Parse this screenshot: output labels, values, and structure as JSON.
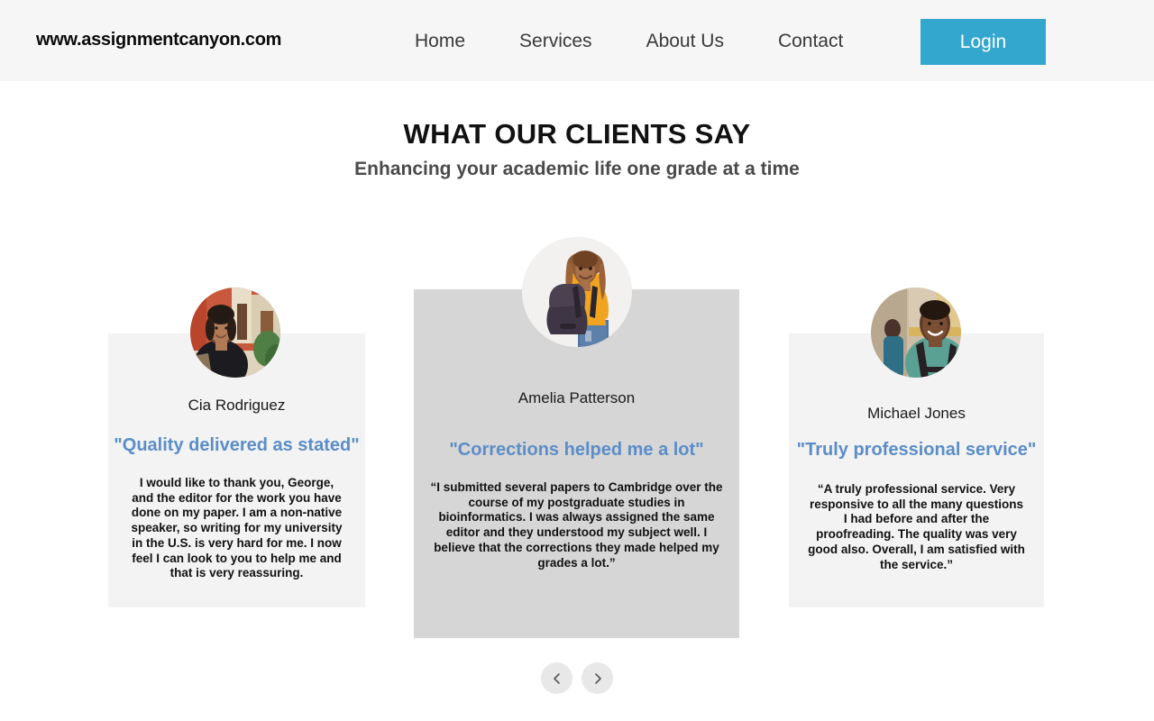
{
  "header": {
    "brand": "www.assignmentcanyon.com",
    "nav": [
      {
        "label": "Home"
      },
      {
        "label": "Services"
      },
      {
        "label": "About Us"
      },
      {
        "label": "Contact"
      }
    ],
    "login_label": "Login",
    "login_color": "#34a7ce",
    "background": "#f6f6f6"
  },
  "section": {
    "title": "WHAT OUR CLIENTS SAY",
    "subtitle": "Enhancing your academic life one grade at a time",
    "headline_color": "#5b8dc8"
  },
  "testimonials": [
    {
      "name": "Cia Rodriguez",
      "headline": "\"Quality delivered as stated\"",
      "quote": "I would like to thank you, George, and the editor for the work you have done on my paper. I am a non-native speaker, so writing for my university in the U.S. is very hard for me. I now feel I can look to you to help me and that is very reassuring.",
      "avatar": "avatar-woman-dark-top",
      "card_color": "#f3f3f3"
    },
    {
      "name": "Amelia Patterson",
      "headline": "\"Corrections helped me a lot\"",
      "quote": "“I submitted several papers to Cambridge over the course of my postgraduate studies in bioinformatics. I was always assigned the same editor and they understood my subject well. I believe that the corrections they made helped my grades a lot.”",
      "avatar": "avatar-woman-yellow-top",
      "card_color": "#d6d6d6"
    },
    {
      "name": "Michael Jones",
      "headline": "\"Truly professional service\"",
      "quote": "“A truly professional service. Very responsive to all the many questions I had before and after the proofreading. The quality was very good also. Overall, I am satisfied with the service.”",
      "avatar": "avatar-man-teal-shirt",
      "card_color": "#f3f3f3"
    }
  ],
  "carousel": {
    "prev_icon": "chevron-left-icon",
    "next_icon": "chevron-right-icon",
    "button_color": "#e8e8e8"
  }
}
